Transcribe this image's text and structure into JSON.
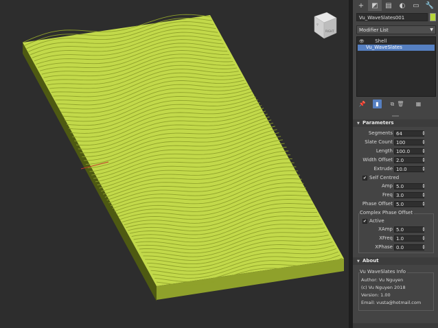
{
  "viewport": {
    "model_color": "#c2d94a",
    "model_dark": "#8fa12b",
    "model_side": "#4e5a12",
    "bg": "#2d2d2d",
    "viewcube_label": "RIGHT"
  },
  "toolbar": {
    "icons": [
      "create-icon",
      "modify-icon",
      "hierarchy-icon",
      "motion-icon",
      "display-icon",
      "utilities-icon"
    ]
  },
  "object": {
    "name": "Vu_WaveSlates001",
    "color": "#b7d53a"
  },
  "modifier_list": {
    "label": "Modifier List"
  },
  "stack": {
    "items": [
      {
        "label": "Shell"
      },
      {
        "label": "Vu_WaveSlates"
      }
    ]
  },
  "parameters": {
    "title": "Parameters",
    "segments": {
      "label": "Segments",
      "value": "64"
    },
    "slate_count": {
      "label": "Slate Count",
      "value": "100"
    },
    "length": {
      "label": "Length",
      "value": "100.0"
    },
    "width_offset": {
      "label": "Width Offset",
      "value": "2.0"
    },
    "extrude": {
      "label": "Extrude",
      "value": "10.0"
    },
    "self_centred": {
      "label": "Self Centred",
      "checked": true
    },
    "amp": {
      "label": "Amp",
      "value": "5.0"
    },
    "freq": {
      "label": "Freq",
      "value": "3.0"
    },
    "phase_offset": {
      "label": "Phase Offset",
      "value": "5.0"
    },
    "complex_group": {
      "title": "Complex Phase Offset",
      "active": {
        "label": "Active",
        "checked": true
      },
      "xamp": {
        "label": "XAmp",
        "value": "5.0"
      },
      "xfreq": {
        "label": "XFreq",
        "value": "1.0"
      },
      "xphase": {
        "label": "XPhase",
        "value": "0.0"
      }
    }
  },
  "about": {
    "title": "About",
    "group_title": "Vu WaveSlates Info",
    "author": "Author: Vu Nguyen",
    "copyright": "(c) Vu Nguyen 2018",
    "version": "Version: 1.00",
    "email": "Email: vusta@hotmail.com"
  }
}
